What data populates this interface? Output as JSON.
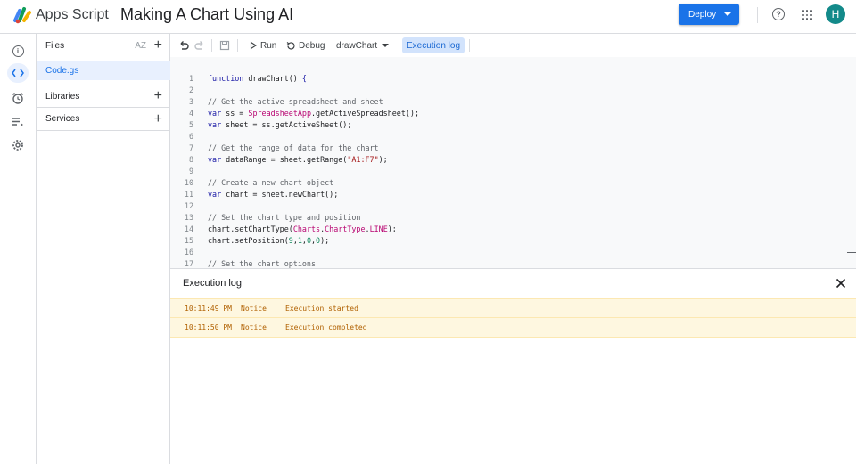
{
  "header": {
    "app_name": "Apps Script",
    "project_title": "Making A Chart Using AI",
    "deploy_label": "Deploy",
    "avatar_initial": "H",
    "accent_color": "#1a73e8"
  },
  "rail": {
    "items": [
      {
        "icon": "info-icon"
      },
      {
        "icon": "code-icon",
        "active": true
      },
      {
        "icon": "alarm-clock-icon"
      },
      {
        "icon": "executions-icon"
      },
      {
        "icon": "gear-icon"
      }
    ]
  },
  "files_panel": {
    "files_label": "Files",
    "sort_label": "AZ",
    "file_name": "Code.gs",
    "libraries_label": "Libraries",
    "services_label": "Services"
  },
  "toolbar": {
    "run_label": "Run",
    "debug_label": "Debug",
    "function_name": "drawChart",
    "exec_log_label": "Execution log"
  },
  "editor": {
    "line_numbers": [
      "1",
      "2",
      "3",
      "4",
      "5",
      "6",
      "7",
      "8",
      "9",
      "10",
      "11",
      "12",
      "13",
      "14",
      "15",
      "16",
      "17"
    ],
    "lines": [
      "function drawChart() {",
      "",
      "// Get the active spreadsheet and sheet",
      "var ss = SpreadsheetApp.getActiveSpreadsheet();",
      "var sheet = ss.getActiveSheet();",
      "",
      "// Get the range of data for the chart",
      "var dataRange = sheet.getRange(\"A1:F7\");",
      "",
      "// Create a new chart object",
      "var chart = sheet.newChart();",
      "",
      "// Set the chart type and position",
      "chart.setChartType(Charts.ChartType.LINE);",
      "chart.setPosition(9,1,0,0);",
      "",
      "// Set the chart options"
    ]
  },
  "log": {
    "title": "Execution log",
    "entries": [
      {
        "time": "10:11:49 PM",
        "level": "Notice",
        "message": "Execution started"
      },
      {
        "time": "10:11:50 PM",
        "level": "Notice",
        "message": "Execution completed"
      }
    ]
  }
}
